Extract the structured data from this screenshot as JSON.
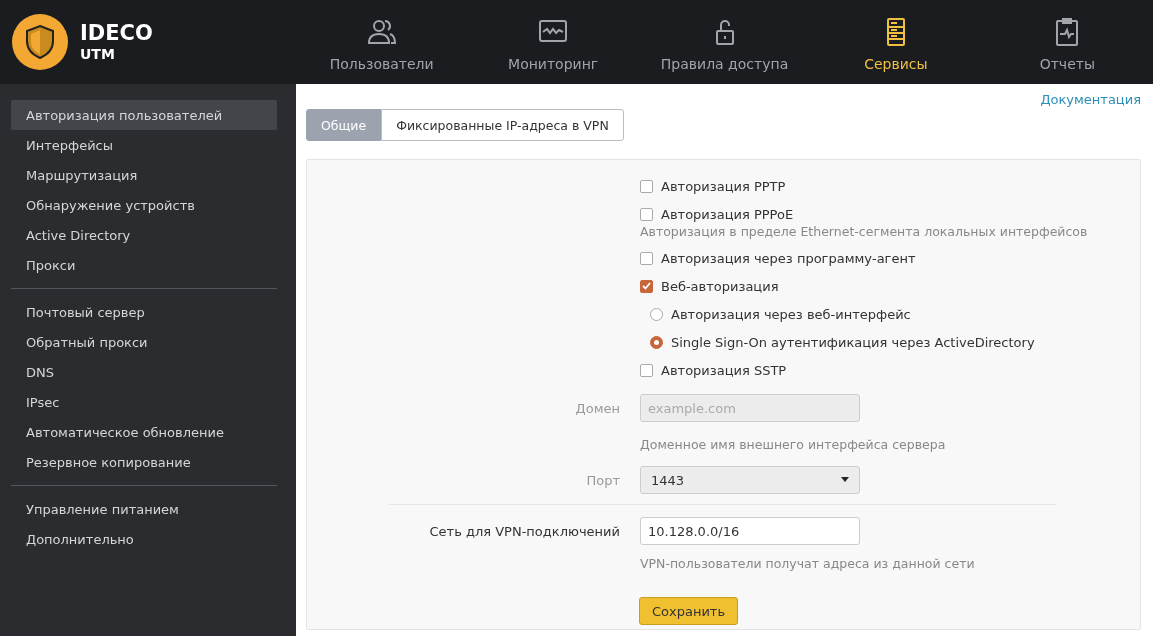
{
  "logo": {
    "title": "IDECO",
    "subtitle": "UTM"
  },
  "nav": [
    {
      "kind": "users",
      "label": "Пользователи",
      "selected": false
    },
    {
      "kind": "monitor",
      "label": "Мониторинг",
      "selected": false
    },
    {
      "kind": "lock",
      "label": "Правила доступа",
      "selected": false
    },
    {
      "kind": "server",
      "label": "Сервисы",
      "selected": true
    },
    {
      "kind": "report",
      "label": "Отчеты",
      "selected": false
    }
  ],
  "sidebar": {
    "groups": [
      {
        "items": [
          {
            "label": "Авторизация пользователей",
            "selected": true
          },
          {
            "label": "Интерфейсы",
            "selected": false
          },
          {
            "label": "Маршрутизация",
            "selected": false
          },
          {
            "label": "Обнаружение устройств",
            "selected": false
          },
          {
            "label": "Active Directory",
            "selected": false
          },
          {
            "label": "Прокси",
            "selected": false
          }
        ]
      },
      {
        "items": [
          {
            "label": "Почтовый сервер",
            "selected": false
          },
          {
            "label": "Обратный прокси",
            "selected": false
          },
          {
            "label": "DNS",
            "selected": false
          },
          {
            "label": "IPsec",
            "selected": false
          },
          {
            "label": "Автоматическое обновление",
            "selected": false
          },
          {
            "label": "Резервное копирование",
            "selected": false
          }
        ]
      },
      {
        "items": [
          {
            "label": "Управление питанием",
            "selected": false
          },
          {
            "label": "Дополнительно",
            "selected": false
          }
        ]
      }
    ]
  },
  "doc_link": "Документация",
  "tabs": [
    {
      "label": "Общие",
      "selected": true
    },
    {
      "label": "Фиксированные IP-адреса в VPN",
      "selected": false
    }
  ],
  "options": [
    {
      "kind": "checkbox",
      "label": "Авторизация PPTP",
      "checked": false
    },
    {
      "kind": "checkbox",
      "label": "Авторизация PPPoE",
      "checked": false
    },
    {
      "kind": "hint",
      "label": "Авторизация в пределе Ethernet-сегмента локальных интерфейсов"
    },
    {
      "kind": "checkbox",
      "label": "Авторизация через программу-агент",
      "checked": false
    },
    {
      "kind": "checkbox",
      "label": "Веб-авторизация",
      "checked": true
    },
    {
      "kind": "radio",
      "label": "Авторизация через веб-интерфейс",
      "selected": false
    },
    {
      "kind": "radio",
      "label": "Single Sign-On аутентификация через ActiveDirectory",
      "selected": true
    },
    {
      "kind": "checkbox",
      "label": "Авторизация SSTP",
      "checked": false
    }
  ],
  "domain": {
    "label": "Домен",
    "placeholder": "example.com",
    "hint": "Доменное имя внешнего интерфейса сервера",
    "disabled": true
  },
  "port": {
    "label": "Порт",
    "value": "1443",
    "disabled": true
  },
  "vpn_network": {
    "label": "Сеть для VPN-подключений",
    "value": "10.128.0.0/16",
    "hint": "VPN-пользователи получат адреса из данной сети"
  },
  "save_button": "Сохранить"
}
